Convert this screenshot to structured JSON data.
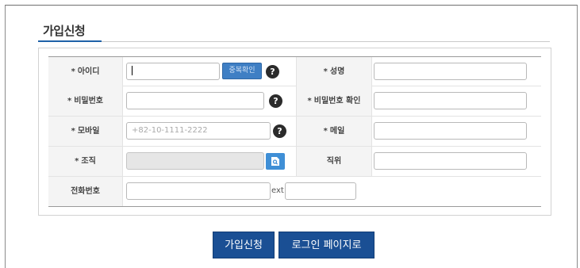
{
  "title": "가입신청",
  "form": {
    "required_mark": "*",
    "id_label": "아이디",
    "id_value": "",
    "dup_check_label": "중복확인",
    "name_label": "성명",
    "password_label": "비밀번호",
    "password_confirm_label": "비밀번호 확인",
    "mobile_label": "모바일",
    "mobile_placeholder": "+82-10-1111-2222",
    "email_label": "메일",
    "org_label": "조직",
    "position_label": "직위",
    "phone_label": "전화번호",
    "ext_label": "ext",
    "help_glyph": "?"
  },
  "buttons": {
    "submit": "가입신청",
    "login": "로그인 페이지로"
  },
  "colors": {
    "accent": "#1a4f94",
    "dup_button": "#3f7fc4",
    "org_button": "#3f8fd6"
  },
  "icons": {
    "help": "question-circle-icon",
    "org_search": "document-search-icon"
  }
}
